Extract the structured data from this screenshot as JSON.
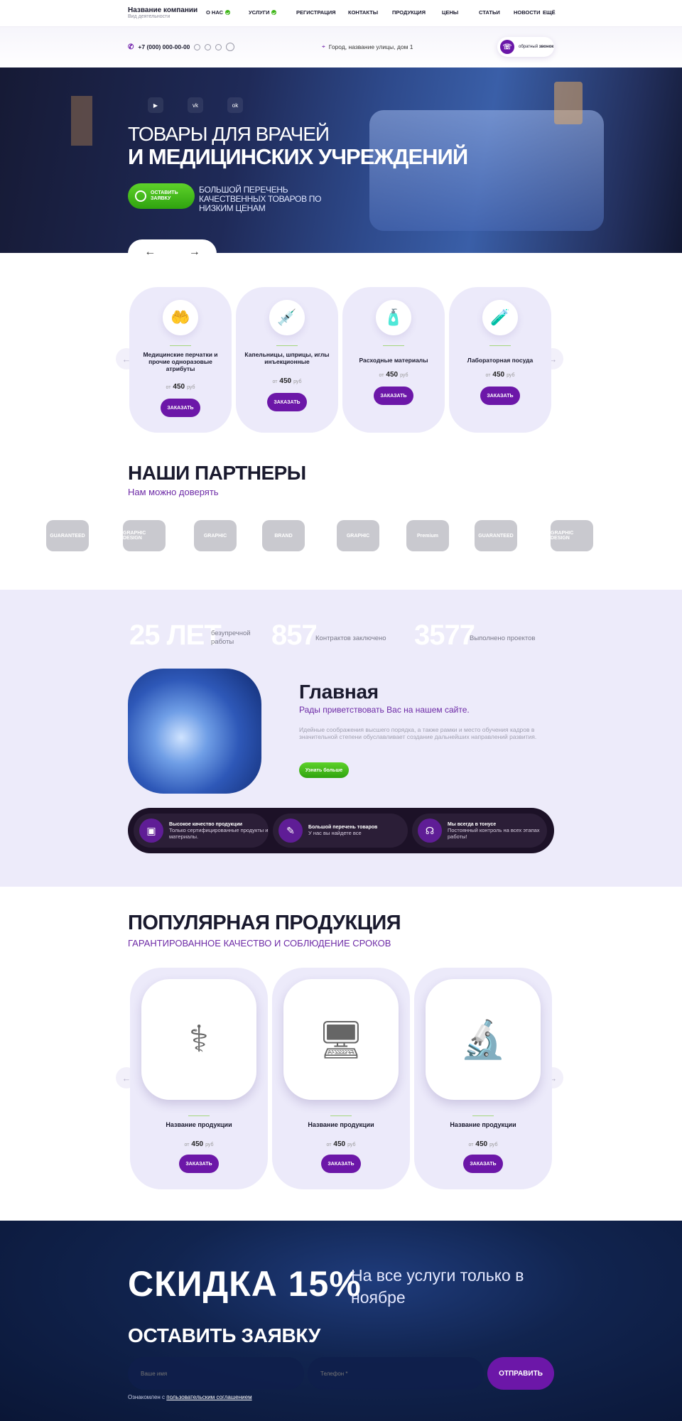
{
  "header": {
    "company_name": "Название компании",
    "company_sub": "Вид деятельности",
    "nav": [
      {
        "label": "О нас",
        "dot": true
      },
      {
        "label": "Услуги",
        "dot": true
      },
      {
        "label": "Регистрация",
        "dot": false
      },
      {
        "label": "Контакты",
        "dot": false
      },
      {
        "label": "Продукция",
        "dot": false
      },
      {
        "label": "Цены",
        "dot": false
      },
      {
        "label": "Статьи",
        "dot": false
      },
      {
        "label": "Новости",
        "dot": false
      },
      {
        "label": "Ещё",
        "dot": false
      }
    ],
    "phone": "+7 (000) 000-00-00",
    "address": "Город, название улицы, дом 1",
    "callback_small": "обратный",
    "callback_bold": "звонок"
  },
  "hero": {
    "social": [
      "▶",
      "vk",
      "ok"
    ],
    "title_light": "ТОВАРЫ ДЛЯ ВРАЧЕЙ",
    "title_bold": "И МЕДИЦИНСКИХ УЧРЕЖДЕНИЙ",
    "cta_line1": "ОСТАВИТЬ",
    "cta_line2": "ЗАЯВКУ",
    "text": "БОЛЬШОЙ ПЕРЕЧЕНЬ КАЧЕСТВЕННЫХ ТОВАРОВ ПО НИЗКИМ ЦЕНАМ",
    "prev": "←",
    "next": "→"
  },
  "categories": [
    {
      "title": "Медицинские перчатки и прочие одноразовые атрибуты",
      "price_from": "от",
      "price": "450",
      "currency": "руб",
      "button": "ЗАКАЗАТЬ",
      "icon": "🤲"
    },
    {
      "title": "Капельницы, шприцы, иглы инъекционные",
      "price_from": "от",
      "price": "450",
      "currency": "руб",
      "button": "ЗАКАЗАТЬ",
      "icon": "💉"
    },
    {
      "title": "Расходные материалы",
      "price_from": "от",
      "price": "450",
      "currency": "руб",
      "button": "ЗАКАЗАТЬ",
      "icon": "🧴"
    },
    {
      "title": "Лабораторная посуда",
      "price_from": "от",
      "price": "450",
      "currency": "руб",
      "button": "ЗАКАЗАТЬ",
      "icon": "🧪"
    }
  ],
  "partners": {
    "title": "НАШИ ПАРТНЕРЫ",
    "subtitle": "Нам можно доверять",
    "logos": [
      "GUARANTEED",
      "GRAPHIC DESIGN",
      "GRAPHIC",
      "BRAND",
      "GRAPHIC",
      "Premium",
      "GUARANTEED",
      "GRAPHIC DESIGN"
    ]
  },
  "stats": [
    {
      "number": "25 ЛЕТ",
      "label": "безупречной работы"
    },
    {
      "number": "857",
      "label": "Контрактов заключено"
    },
    {
      "number": "3577",
      "label": "Выполнено проектов"
    }
  ],
  "about": {
    "title": "Главная",
    "subtitle": "Рады приветствовать Вас на нашем сайте.",
    "text": "Идейные соображения высшего порядка, а также рамки и место обучения кадров в значительной степени обуславливает создание дальнейших направлений развития.",
    "button": "Узнать больше"
  },
  "features": [
    {
      "title": "Высокое качество продукции",
      "text": "Только сертифицированные продукты и материалы.",
      "icon": "▣"
    },
    {
      "title": "Большой перечень товаров",
      "text": "У нас вы найдете все",
      "icon": "✎"
    },
    {
      "title": "Мы всегда в тонусе",
      "text": "Постоянный контроль на всех этапах работы!",
      "icon": "☊"
    }
  ],
  "popular": {
    "title": "ПОПУЛЯРНАЯ ПРОДУКЦИЯ",
    "subtitle": "ГАРАНТИРОВАННОЕ КАЧЕСТВО И СОБЛЮДЕНИЕ СРОКОВ",
    "items": [
      {
        "title": "Название продукции",
        "price_from": "от",
        "price": "450",
        "currency": "руб",
        "button": "ЗАКАЗАТЬ",
        "icon": "⚕"
      },
      {
        "title": "Название продукции",
        "price_from": "от",
        "price": "450",
        "currency": "руб",
        "button": "ЗАКАЗАТЬ",
        "icon": "🖥"
      },
      {
        "title": "Название продукции",
        "price_from": "от",
        "price": "450",
        "currency": "руб",
        "button": "ЗАКАЗАТЬ",
        "icon": "🔬"
      }
    ]
  },
  "discount": {
    "big": "СКИДКА 15%",
    "text": "На все услуги только в ноябре",
    "form_title": "ОСТАВИТЬ ЗАЯВКУ",
    "name_placeholder": "Ваше имя",
    "phone_placeholder": "Телефон *",
    "submit": "ОТПРАВИТЬ",
    "agree_text": "Ознакомлен с ",
    "agree_link": "пользовательским соглашением"
  },
  "colors": {
    "accent": "#6c17a8",
    "green": "#3fb618",
    "card_bg": "#eceafa",
    "dark_bg": "#0f1d45"
  }
}
